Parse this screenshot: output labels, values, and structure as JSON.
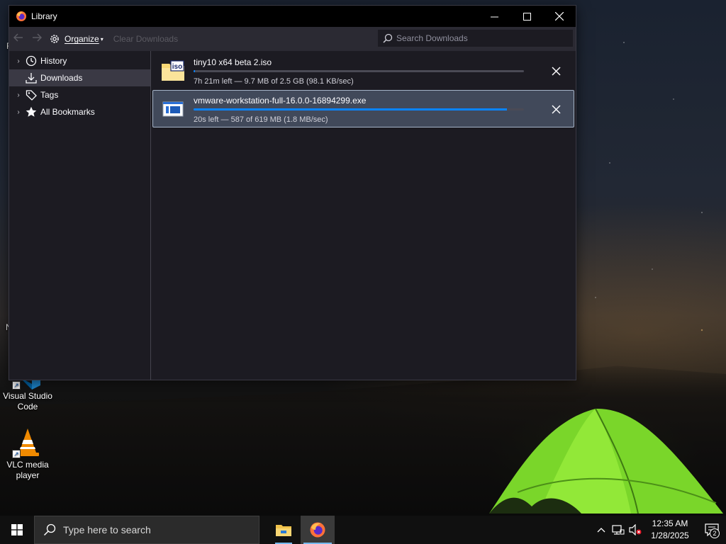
{
  "window": {
    "title": "Library",
    "controls": {
      "minimize": "—",
      "maximize": "☐",
      "close": "✕"
    }
  },
  "toolbar": {
    "back_icon": "arrow-left-icon",
    "forward_icon": "arrow-right-icon",
    "organize_label": "Organize",
    "clear_label": "Clear Downloads",
    "search_placeholder": "Search Downloads"
  },
  "sidebar": {
    "items": [
      {
        "label": "History",
        "icon": "clock-icon",
        "expandable": true,
        "selected": false
      },
      {
        "label": "Downloads",
        "icon": "download-icon",
        "expandable": false,
        "selected": true
      },
      {
        "label": "Tags",
        "icon": "tag-icon",
        "expandable": true,
        "selected": false
      },
      {
        "label": "All Bookmarks",
        "icon": "star-icon",
        "expandable": true,
        "selected": false
      }
    ]
  },
  "downloads": [
    {
      "name": "tiny10 x64 beta 2.iso",
      "status": "7h 21m left — 9.7 MB of 2.5 GB (98.1 KB/sec)",
      "progress": 0.004,
      "icon": "iso-file-icon",
      "selected": false
    },
    {
      "name": "vmware-workstation-full-16.0.0-16894299.exe",
      "status": "20s left — 587 of 619 MB (1.8 MB/sec)",
      "progress": 0.948,
      "icon": "exe-file-icon",
      "selected": true
    }
  ],
  "desktop": {
    "icons": [
      {
        "label": "Visual Studio Code",
        "icon": "vscode-icon"
      },
      {
        "label": "VLC media player",
        "icon": "vlc-icon"
      }
    ],
    "edge_glyphs": [
      "F",
      "N"
    ]
  },
  "taskbar": {
    "search_placeholder": "Type here to search",
    "apps": [
      "file-explorer-icon",
      "firefox-icon"
    ],
    "time": "12:35 AM",
    "date": "1/28/2025",
    "notification_count": "2"
  },
  "colors": {
    "accent": "#0a84ff",
    "window_bg": "#1c1b22",
    "toolbar_bg": "#2b2a33",
    "selection_bg": "#41495a"
  }
}
